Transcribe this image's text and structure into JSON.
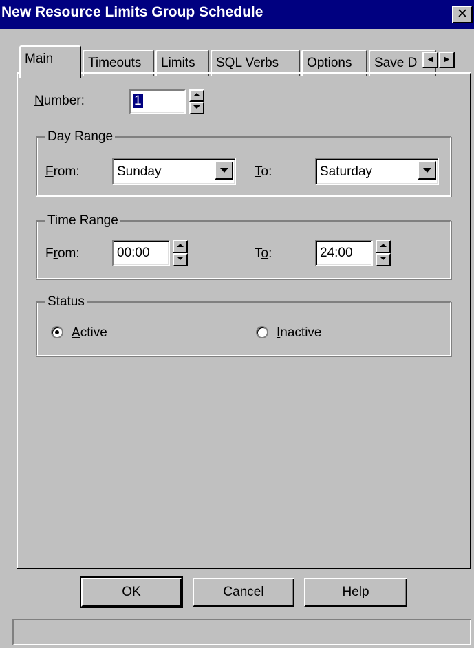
{
  "window": {
    "title": "New Resource Limits Group Schedule",
    "close_glyph": "✕"
  },
  "tabs": [
    {
      "label": "Main",
      "active": true
    },
    {
      "label": "Timeouts",
      "active": false
    },
    {
      "label": "Limits",
      "active": false
    },
    {
      "label": "SQL Verbs",
      "active": false
    },
    {
      "label": "Options",
      "active": false
    },
    {
      "label": "Save D",
      "active": false
    }
  ],
  "tab_scroll": {
    "left_icon": "◀",
    "right_icon": "▶"
  },
  "main": {
    "number": {
      "label_prefix": "N",
      "label_rest": "umber:",
      "value": "1"
    },
    "day_range": {
      "legend": "Day Range",
      "from": {
        "label_prefix": "F",
        "label_rest": "rom:",
        "value": "Sunday"
      },
      "to": {
        "label_prefix": "T",
        "label_rest": "o:",
        "value": "Saturday"
      }
    },
    "time_range": {
      "legend": "Time Range",
      "from": {
        "label_prefix": "F",
        "label_mid": "r",
        "label_rest": "om:",
        "value": "00:00"
      },
      "to": {
        "label_prefix": "T",
        "label_mid": "o",
        "label_rest": ":",
        "value": "24:00"
      }
    },
    "status": {
      "legend": "Status",
      "active": {
        "label_prefix": "A",
        "label_rest": "ctive",
        "selected": true
      },
      "inactive": {
        "label_prefix": "I",
        "label_rest": "nactive",
        "selected": false
      }
    }
  },
  "buttons": {
    "ok": "OK",
    "cancel": "Cancel",
    "help": "Help"
  },
  "colors": {
    "titlebar": "#000080",
    "face": "#c0c0c0",
    "selection": "#000080"
  }
}
